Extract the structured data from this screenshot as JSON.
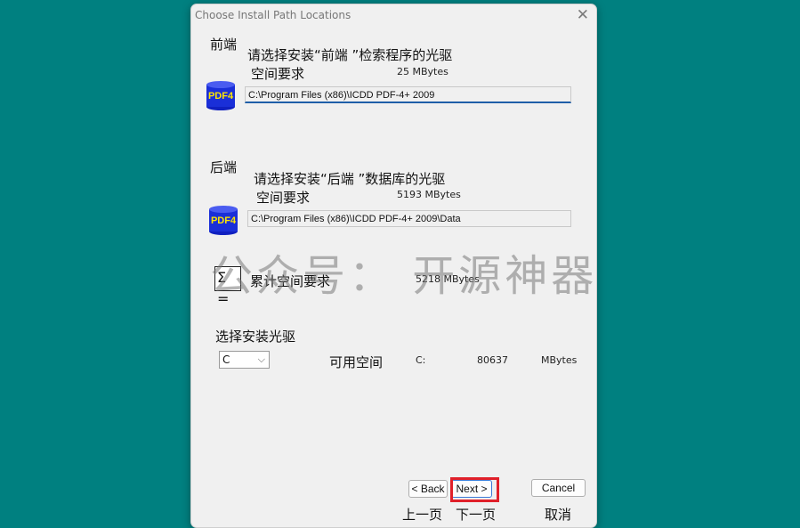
{
  "dialog": {
    "title": "Choose Install Path Locations",
    "close_glyph": "✕"
  },
  "frontend": {
    "section_label": "前端",
    "prompt": "请选择安装“前端 ”检索程序的光驱",
    "space_label": "空间要求",
    "space_value": "25 MBytes",
    "icon_text": "PDF4",
    "path": "C:\\Program Files (x86)\\ICDD PDF-4+ 2009"
  },
  "backend": {
    "section_label": "后端",
    "prompt": "请选择安装“后端 ”数据库的光驱",
    "space_label": "空间要求",
    "space_value": "5193 MBytes",
    "icon_text": "PDF4",
    "path": "C:\\Program Files (x86)\\ICDD PDF-4+ 2009\\Data"
  },
  "total": {
    "icon_glyph": "Σ =",
    "label": "累计空间要求",
    "value": "5218 MBytes"
  },
  "drive": {
    "section_label": "选择安装光驱",
    "selected": "C",
    "available_label": "可用空间",
    "drive_letter": "C:",
    "available_value": "80637",
    "unit": "MBytes"
  },
  "buttons": {
    "back": "< Back",
    "next": "Next >",
    "cancel": "Cancel",
    "back_caption": "上一页",
    "next_caption": "下一页",
    "cancel_caption": "取消"
  },
  "watermark": "公众号：  开源神器"
}
